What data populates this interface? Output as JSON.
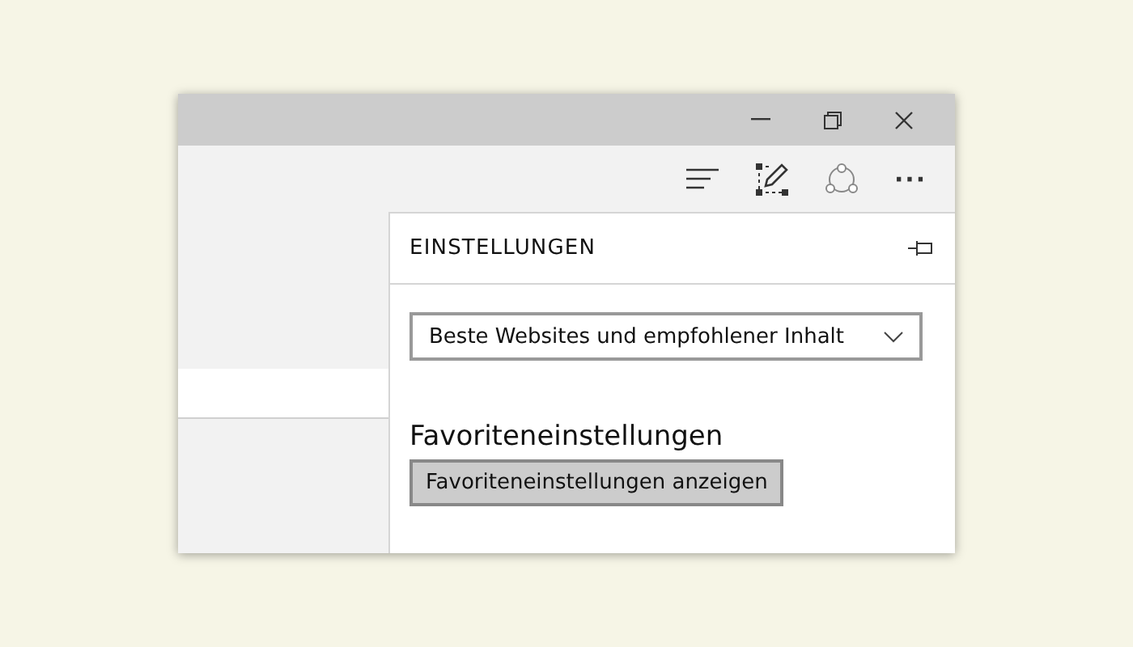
{
  "window": {
    "controls": [
      {
        "kind": "minimize"
      },
      {
        "kind": "restore"
      },
      {
        "kind": "close"
      }
    ]
  },
  "toolbar": {
    "buttons": [
      {
        "kind": "hub"
      },
      {
        "kind": "note"
      },
      {
        "kind": "share"
      },
      {
        "kind": "more",
        "label": "···"
      }
    ]
  },
  "settings_panel": {
    "title": "EINSTELLUNGEN",
    "pinned": false,
    "new_tabs_dropdown": {
      "value": "Beste Websites und empfohlener Inhalt"
    },
    "favorites_heading": "Favoriteneinstellungen",
    "favorites_button": "Favoriteneinstellungen anzeigen"
  }
}
